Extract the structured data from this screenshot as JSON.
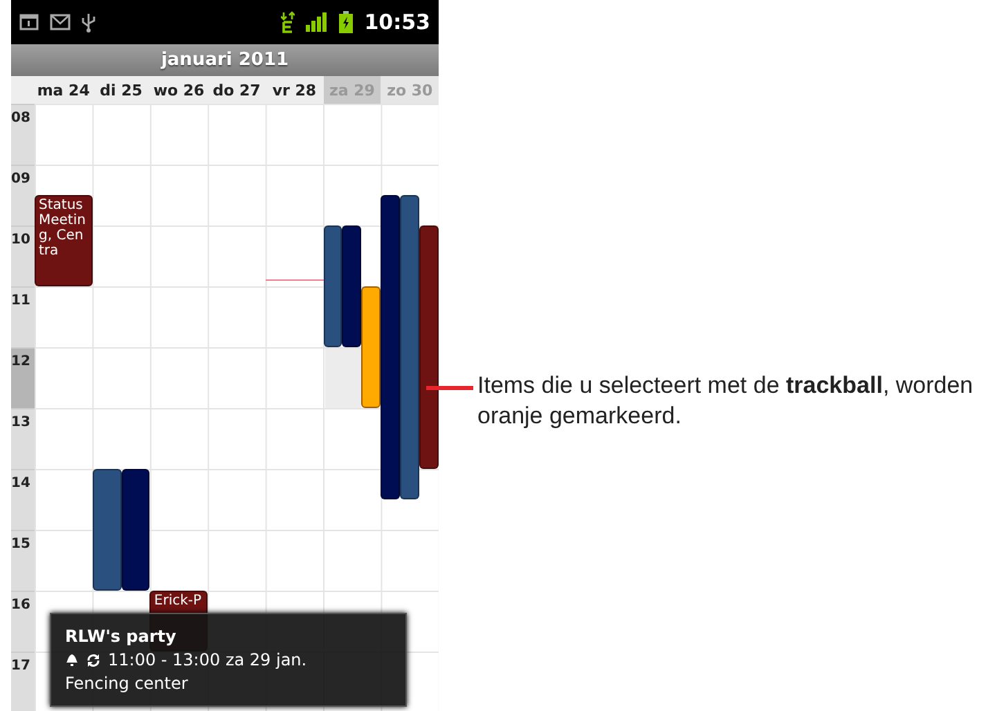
{
  "status_bar": {
    "time": "10:53"
  },
  "month_title": "januari 2011",
  "days": [
    {
      "label": "ma 24",
      "weekend": false,
      "selected": false
    },
    {
      "label": "di 25",
      "weekend": false,
      "selected": false
    },
    {
      "label": "wo 26",
      "weekend": false,
      "selected": false
    },
    {
      "label": "do 27",
      "weekend": false,
      "selected": false
    },
    {
      "label": "vr 28",
      "weekend": false,
      "selected": false
    },
    {
      "label": "za 29",
      "weekend": true,
      "selected": true
    },
    {
      "label": "zo 30",
      "weekend": true,
      "selected": false
    }
  ],
  "hours": [
    {
      "label": "08",
      "selected": false
    },
    {
      "label": "09",
      "selected": false
    },
    {
      "label": "10",
      "selected": false
    },
    {
      "label": "11",
      "selected": false
    },
    {
      "label": "12",
      "selected": true
    },
    {
      "label": "13",
      "selected": false
    },
    {
      "label": "14",
      "selected": false
    },
    {
      "label": "15",
      "selected": false
    },
    {
      "label": "16",
      "selected": false
    },
    {
      "label": "17",
      "selected": false
    }
  ],
  "events": [
    {
      "title": "Status Meeting, Centra",
      "color": "#6f1212",
      "selected": false
    },
    {
      "color": "#2a5080",
      "selected": false
    },
    {
      "color": "#000d52",
      "selected": false
    },
    {
      "color": "#ffaa00",
      "selected": true
    },
    {
      "color": "#000d52",
      "selected": false
    },
    {
      "color": "#2a5080",
      "selected": false
    },
    {
      "color": "#6f1212",
      "selected": false
    },
    {
      "color": "#2a5080",
      "selected": false
    },
    {
      "color": "#000d52",
      "selected": false
    },
    {
      "title": "Erick-P",
      "color": "#6f1212",
      "selected": false
    }
  ],
  "popup": {
    "title": "RLW's party",
    "time": "11:00 - 13:00 za 29 jan.",
    "location": "Fencing center",
    "reminder": true,
    "repeating": true
  },
  "callout": "Items die u selecteert met de **trackball**, worden oranje gemarkeerd."
}
